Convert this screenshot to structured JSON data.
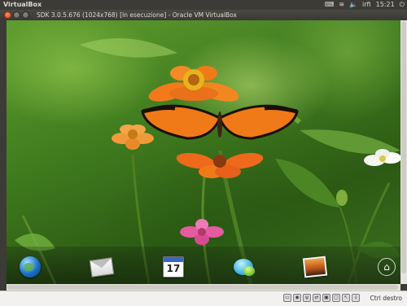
{
  "top_panel": {
    "app_title": "VirtualBox",
    "clock": "15:21",
    "user": "irfi",
    "icons": [
      "keyboard-icon",
      "wifi-icon",
      "volume-icon",
      "battery-icon",
      "mail-indicator-icon",
      "power-icon"
    ]
  },
  "window": {
    "title": "SDK 3.0.5.676 (1024x768) [In esecuzione] - Oracle VM VirtualBox",
    "controls": [
      "close",
      "minimize",
      "maximize"
    ]
  },
  "guest": {
    "wallpaper": "orange butterfly on orange zinnia flower, green garden background",
    "dock_icons": [
      "browser-icon",
      "mail-icon",
      "calendar-icon",
      "messaging-icon",
      "gallery-icon",
      "home-icon"
    ],
    "calendar_day": "17"
  },
  "statusbar": {
    "icons": [
      "hard-disk-icon",
      "optical-drive-icon",
      "usb-icon",
      "network-icon",
      "shared-folder-icon",
      "display-icon",
      "mouse-integration-icon",
      "host-key-icon"
    ],
    "host_key": "Ctrl destro"
  },
  "colors": {
    "panel": "#3c3b37",
    "butterfly": "#f07a17",
    "flower": "#ef6a1a",
    "close_button": "#df4a16"
  }
}
